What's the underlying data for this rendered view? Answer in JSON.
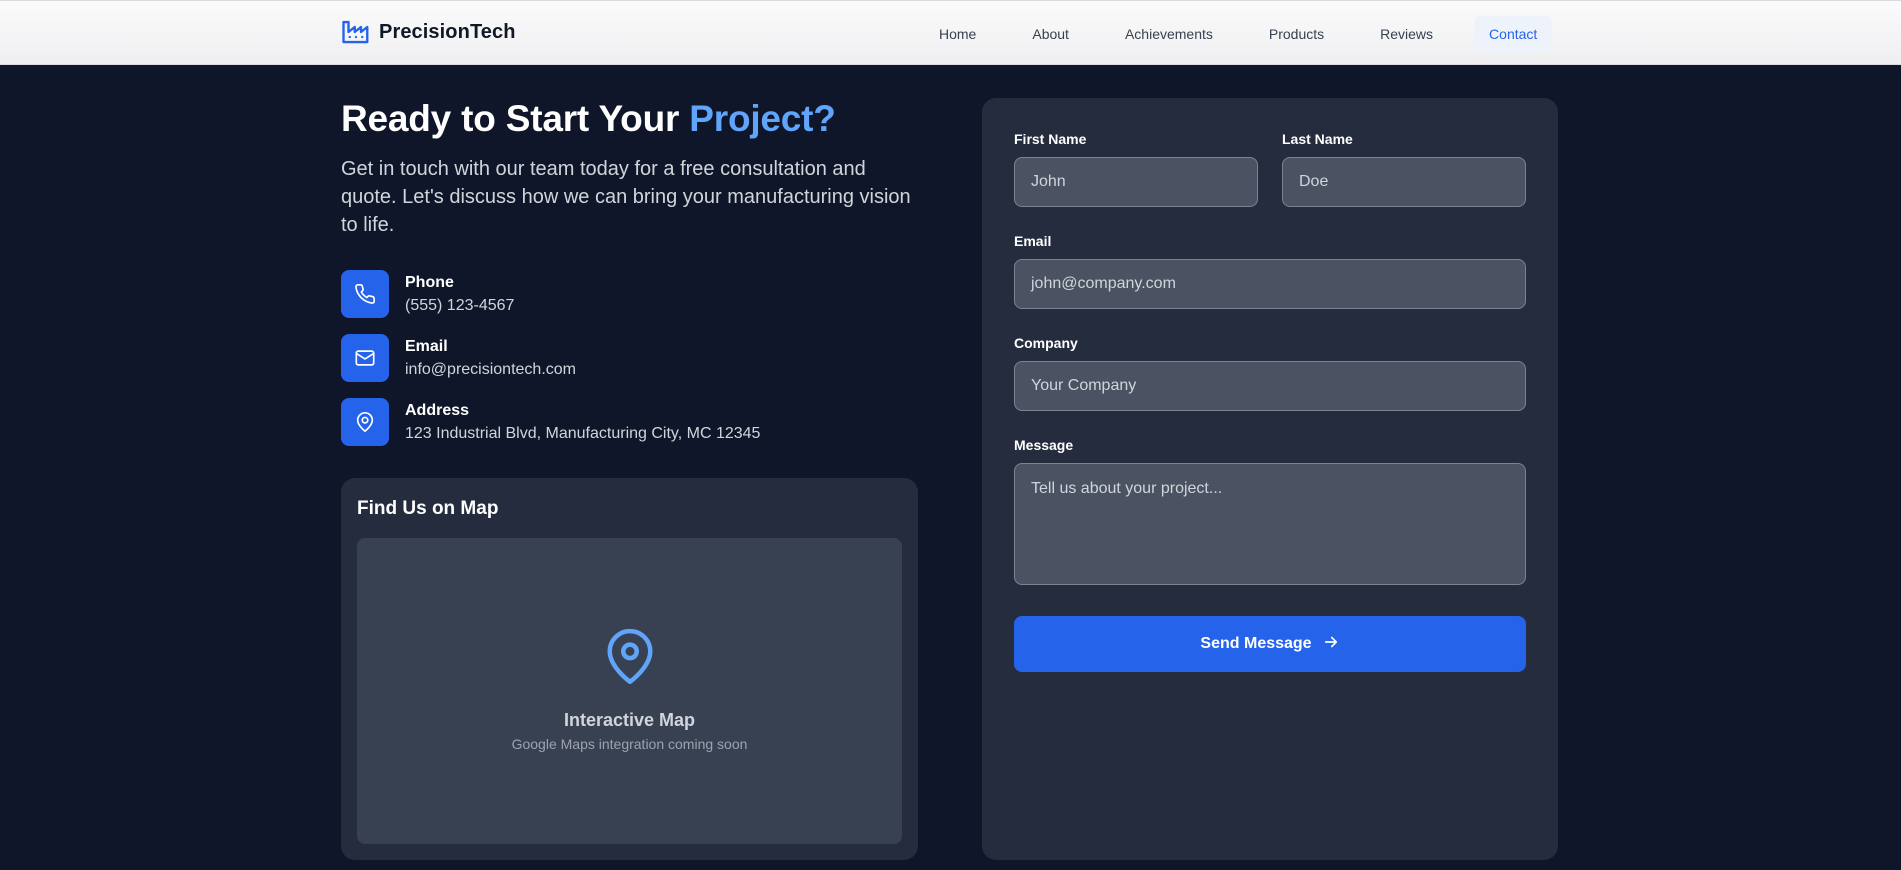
{
  "header": {
    "brand": "PrecisionTech",
    "nav": [
      {
        "label": "Home"
      },
      {
        "label": "About"
      },
      {
        "label": "Achievements"
      },
      {
        "label": "Products"
      },
      {
        "label": "Reviews"
      },
      {
        "label": "Contact",
        "active": true
      }
    ]
  },
  "hero": {
    "title_prefix": "Ready to Start Your ",
    "title_accent": "Project?",
    "intro": "Get in touch with our team today for a free consultation and quote. Let's discuss how we can bring your manufacturing vision to life."
  },
  "contact": {
    "phone": {
      "label": "Phone",
      "value": "(555) 123-4567",
      "icon": "phone-icon"
    },
    "email": {
      "label": "Email",
      "value": "info@precisiontech.com",
      "icon": "mail-icon"
    },
    "address": {
      "label": "Address",
      "value": "123 Industrial Blvd, Manufacturing City, MC 12345",
      "icon": "map-pin-icon"
    }
  },
  "map": {
    "title": "Find Us on Map",
    "label": "Interactive Map",
    "sub": "Google Maps integration coming soon"
  },
  "form": {
    "first_name": {
      "label": "First Name",
      "placeholder": "John"
    },
    "last_name": {
      "label": "Last Name",
      "placeholder": "Doe"
    },
    "email": {
      "label": "Email",
      "placeholder": "john@company.com"
    },
    "company": {
      "label": "Company",
      "placeholder": "Your Company"
    },
    "message": {
      "label": "Message",
      "placeholder": "Tell us about your project..."
    },
    "submit": "Send Message"
  },
  "colors": {
    "background": "#0f1629",
    "card": "#252c3e",
    "accent": "#2563eb",
    "accent_text": "#60a5fa"
  }
}
